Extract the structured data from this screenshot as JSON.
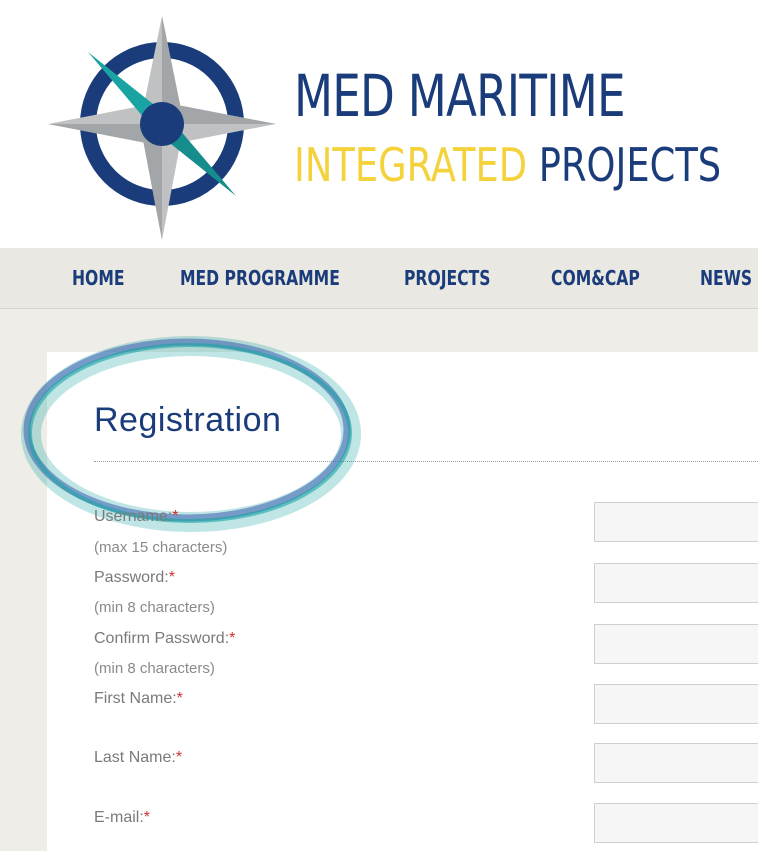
{
  "header": {
    "logo_line1": "MED MARITIME",
    "logo_line2_yellow": "INTEGRATED",
    "logo_line2_blue": "PROJECTS"
  },
  "nav": {
    "items": [
      {
        "label": "HOME"
      },
      {
        "label": "MED PROGRAMME"
      },
      {
        "label": "PROJECTS"
      },
      {
        "label": "COM&CAP"
      },
      {
        "label": "NEWS"
      }
    ]
  },
  "form": {
    "title": "Registration",
    "required_marker": "*",
    "fields": [
      {
        "label": "Username:",
        "hint": "(max 15 characters)",
        "value": ""
      },
      {
        "label": "Password:",
        "hint": "(min 8 characters)",
        "value": ""
      },
      {
        "label": "Confirm Password:",
        "hint": "(min 8 characters)",
        "value": ""
      },
      {
        "label": "First Name:",
        "hint": "",
        "value": ""
      },
      {
        "label": "Last Name:",
        "hint": "",
        "value": ""
      },
      {
        "label": "E-mail:",
        "hint": "",
        "value": ""
      }
    ]
  },
  "colors": {
    "brand_blue": "#1a3c7a",
    "brand_yellow": "#f4d23c",
    "teal": "#1aa3a3",
    "nav_bg": "#e9e8e3",
    "required_red": "#d03030"
  }
}
